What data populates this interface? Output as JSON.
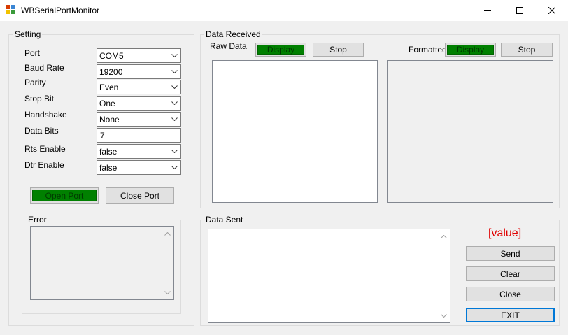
{
  "window": {
    "title": "WBSerialPortMonitor"
  },
  "setting": {
    "group_label": "Setting",
    "fields": [
      {
        "label": "Port",
        "value": "COM5",
        "kind": "combo"
      },
      {
        "label": "Baud Rate",
        "value": "19200",
        "kind": "combo"
      },
      {
        "label": "Parity",
        "value": "Even",
        "kind": "combo"
      },
      {
        "label": "Stop Bit",
        "value": "One",
        "kind": "combo"
      },
      {
        "label": "Handshake",
        "value": "None",
        "kind": "combo"
      },
      {
        "label": "Data Bits",
        "value": "7",
        "kind": "text"
      },
      {
        "label": "Rts Enable",
        "value": "false",
        "kind": "combo"
      },
      {
        "label": "Dtr Enable",
        "value": "false",
        "kind": "combo"
      }
    ],
    "open_port_label": "Open Port",
    "close_port_label": "Close Port",
    "error_label": "Error"
  },
  "data_received": {
    "group_label": "Data Received",
    "raw_label": "Raw Data",
    "raw_display_label": "Display",
    "raw_stop_label": "Stop",
    "formatted_label": "Formatted",
    "formatted_display_label": "Display",
    "formatted_stop_label": "Stop"
  },
  "data_sent": {
    "group_label": "Data Sent",
    "value_label": "[value]",
    "send_label": "Send",
    "clear_label": "Clear",
    "close_label": "Close",
    "exit_label": "EXIT"
  },
  "colors": {
    "display_active": "#008000",
    "value_text": "#e00000",
    "focus_border": "#0078d7"
  }
}
